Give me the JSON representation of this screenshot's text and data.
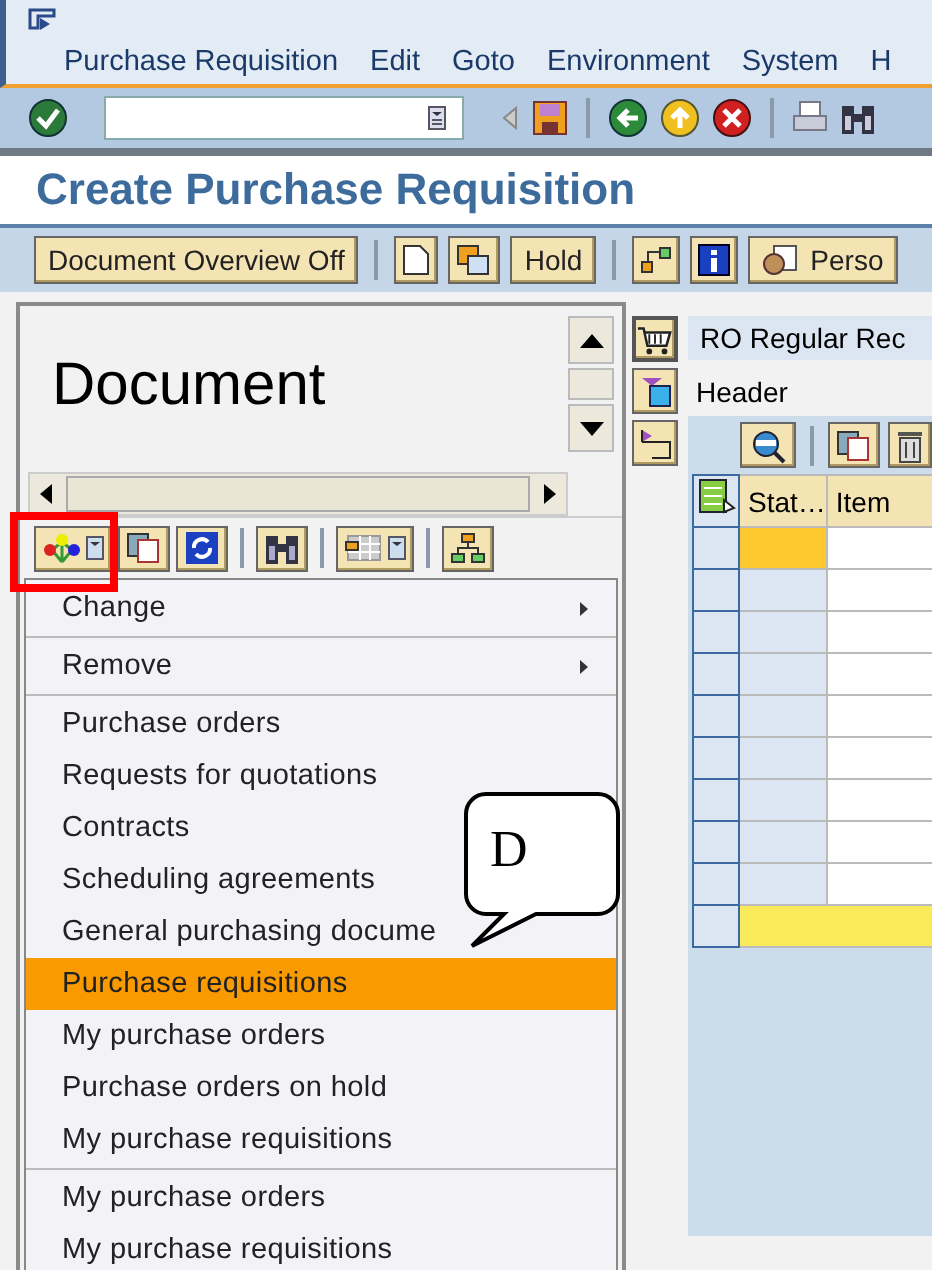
{
  "menu_bar": [
    "Purchase Requisition",
    "Edit",
    "Goto",
    "Environment",
    "System",
    "H"
  ],
  "title": "Create Purchase Requisition",
  "app_toolbar": {
    "overview_button": "Document Overview Off",
    "hold_button": "Hold",
    "personal_button": "Perso"
  },
  "document_overview": {
    "title": "Document"
  },
  "context_menu": {
    "groups": [
      [
        {
          "label": "Change",
          "submenu": true,
          "selected": false
        }
      ],
      [
        {
          "label": "Remove",
          "submenu": true,
          "selected": false
        }
      ],
      [
        {
          "label": "Purchase orders",
          "selected": false
        },
        {
          "label": "Requests for quotations",
          "selected": false
        },
        {
          "label": "Contracts",
          "selected": false
        },
        {
          "label": "Scheduling agreements",
          "selected": false
        },
        {
          "label": "General purchasing docume",
          "selected": false
        },
        {
          "label": "Purchase requisitions",
          "selected": true
        },
        {
          "label": "My purchase orders",
          "selected": false
        },
        {
          "label": "Purchase orders on hold",
          "selected": false
        },
        {
          "label": "My purchase requisitions",
          "selected": false
        }
      ],
      [
        {
          "label": "My purchase orders",
          "selected": false
        },
        {
          "label": "My purchase requisitions",
          "selected": false
        }
      ]
    ]
  },
  "callout": {
    "label": "D"
  },
  "document": {
    "type_field": "RO Regular Rec",
    "header_label": "Header",
    "columns": [
      "Stat…",
      "Item"
    ],
    "rows": [
      {
        "selected": true
      },
      {
        "selected": false
      },
      {
        "selected": false
      },
      {
        "selected": false
      },
      {
        "selected": false
      },
      {
        "selected": false
      },
      {
        "selected": false
      },
      {
        "selected": false
      },
      {
        "selected": false
      }
    ]
  }
}
